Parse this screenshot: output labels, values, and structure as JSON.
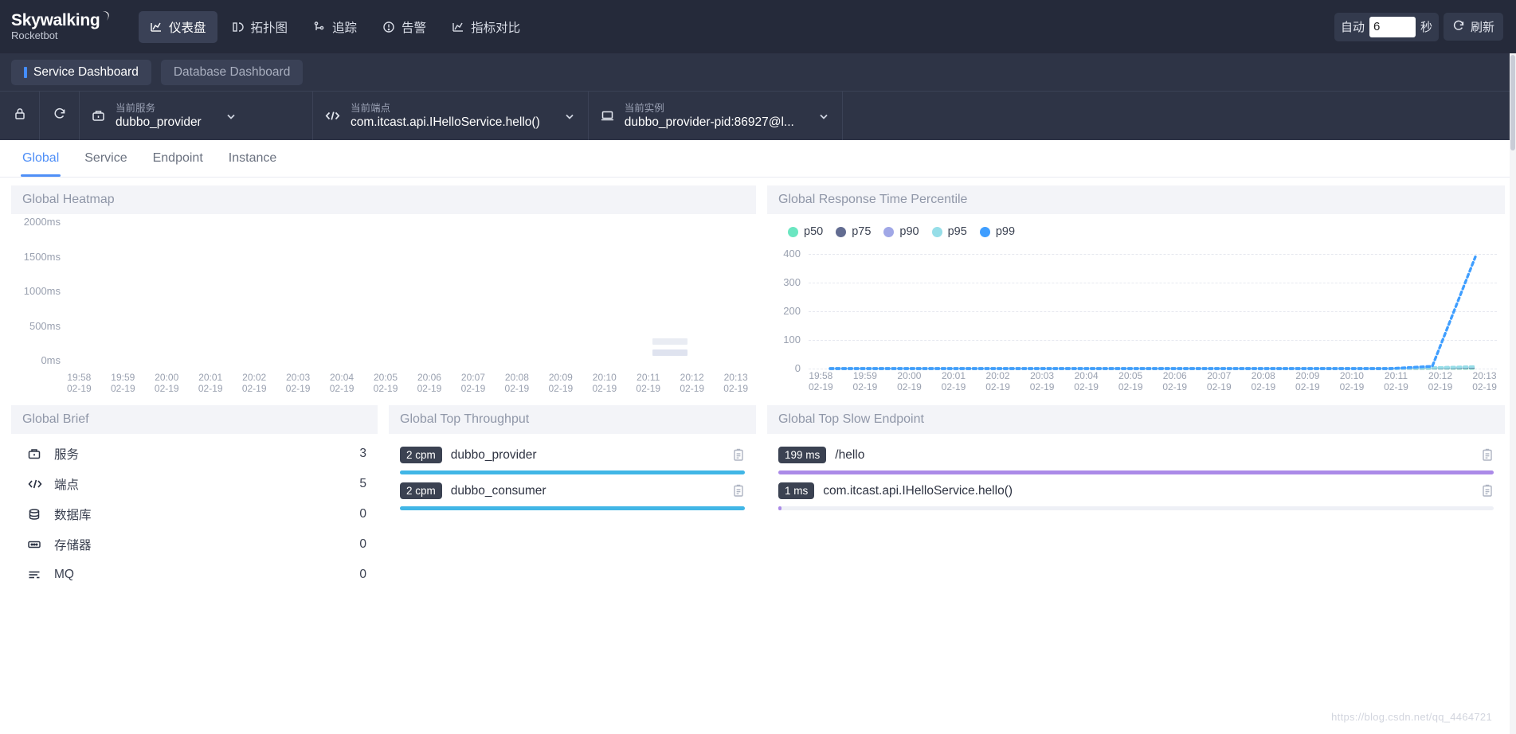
{
  "brand": {
    "name": "Skywalking",
    "sub": "Rocketbot"
  },
  "nav": {
    "items": [
      {
        "label": "仪表盘",
        "icon": "dashboard-icon",
        "active": true
      },
      {
        "label": "拓扑图",
        "icon": "topology-icon",
        "active": false
      },
      {
        "label": "追踪",
        "icon": "trace-icon",
        "active": false
      },
      {
        "label": "告警",
        "icon": "alarm-icon",
        "active": false
      },
      {
        "label": "指标对比",
        "icon": "compare-icon",
        "active": false
      }
    ],
    "auto_label": "自动",
    "auto_value": "6",
    "auto_unit": "秒",
    "refresh_label": "刷新"
  },
  "dashboard_tabs": [
    {
      "label": "Service Dashboard",
      "active": true
    },
    {
      "label": "Database Dashboard",
      "active": false
    }
  ],
  "selectors": {
    "lock_icon": "lock-icon",
    "reload_icon": "reload-icon",
    "service": {
      "label": "当前服务",
      "value": "dubbo_provider",
      "icon": "service-icon"
    },
    "endpoint": {
      "label": "当前端点",
      "value": "com.itcast.api.IHelloService.hello()",
      "icon": "endpoint-code-icon"
    },
    "instance": {
      "label": "当前实例",
      "value": "dubbo_provider-pid:86927@l...",
      "icon": "instance-icon"
    }
  },
  "subtabs": [
    {
      "label": "Global",
      "active": true
    },
    {
      "label": "Service",
      "active": false
    },
    {
      "label": "Endpoint",
      "active": false
    },
    {
      "label": "Instance",
      "active": false
    }
  ],
  "panels": {
    "heatmap_title": "Global Heatmap",
    "percentile_title": "Global Response Time Percentile",
    "brief_title": "Global Brief",
    "throughput_title": "Global Top Throughput",
    "slow_endpoint_title": "Global Top Slow Endpoint"
  },
  "brief": {
    "rows": [
      {
        "icon": "service-icon",
        "name": "服务",
        "value": "3"
      },
      {
        "icon": "endpoint-code-icon",
        "name": "端点",
        "value": "5"
      },
      {
        "icon": "database-icon",
        "name": "数据库",
        "value": "0"
      },
      {
        "icon": "cache-icon",
        "name": "存储器",
        "value": "0"
      },
      {
        "icon": "mq-icon",
        "name": "MQ",
        "value": "0"
      }
    ]
  },
  "top_throughput": {
    "items": [
      {
        "badge": "2 cpm",
        "name": "dubbo_provider",
        "pct": 100,
        "color": "#41b6e6"
      },
      {
        "badge": "2 cpm",
        "name": "dubbo_consumer",
        "pct": 100,
        "color": "#41b6e6"
      }
    ]
  },
  "top_slow_endpoint": {
    "items": [
      {
        "badge": "199 ms",
        "name": "/hello",
        "pct": 100,
        "color": "#ab8ae8"
      },
      {
        "badge": "1 ms",
        "name": "com.itcast.api.IHelloService.hello()",
        "pct": 0.5,
        "color": "#ab8ae8"
      }
    ]
  },
  "watermark": "https://blog.csdn.net/qq_4464721",
  "chart_data": [
    {
      "type": "heatmap",
      "title": "Global Heatmap",
      "xlabel": "",
      "ylabel": "",
      "ylim": [
        0,
        2000
      ],
      "ytick_labels": [
        "2000ms",
        "1500ms",
        "1000ms",
        "500ms",
        "0ms"
      ],
      "yticks": [
        2000,
        1500,
        1000,
        500,
        0
      ],
      "x": [
        "19:58",
        "19:59",
        "20:00",
        "20:01",
        "20:02",
        "20:03",
        "20:04",
        "20:05",
        "20:06",
        "20:07",
        "20:08",
        "20:09",
        "20:10",
        "20:11",
        "20:12",
        "20:13"
      ],
      "xtick_dates": [
        "02-19",
        "02-19",
        "02-19",
        "02-19",
        "02-19",
        "02-19",
        "02-19",
        "02-19",
        "02-19",
        "02-19",
        "02-19",
        "02-19",
        "02-19",
        "02-19",
        "02-19",
        "02-19"
      ],
      "grid": false,
      "cells": [
        {
          "x_index": 14,
          "bucket": "0-100ms",
          "value": 1,
          "color": "#dfe3ef"
        },
        {
          "x_index": 14,
          "bucket": "100-200ms",
          "value": 1,
          "color": "#e9ecf3"
        }
      ],
      "note": "Nearly empty heatmap; two faint light-grey cells near 20:12-20:13 close to the 0ms baseline"
    },
    {
      "type": "line",
      "title": "Global Response Time Percentile",
      "xlabel": "",
      "ylabel": "",
      "ylim": [
        0,
        400
      ],
      "yticks": [
        0,
        100,
        200,
        300,
        400
      ],
      "grid": true,
      "legend_position": "top-left",
      "x": [
        "19:58",
        "19:59",
        "20:00",
        "20:01",
        "20:02",
        "20:03",
        "20:04",
        "20:05",
        "20:06",
        "20:07",
        "20:08",
        "20:09",
        "20:10",
        "20:11",
        "20:12",
        "20:13"
      ],
      "xtick_dates": [
        "02-19",
        "02-19",
        "02-19",
        "02-19",
        "02-19",
        "02-19",
        "02-19",
        "02-19",
        "02-19",
        "02-19",
        "02-19",
        "02-19",
        "02-19",
        "02-19",
        "02-19",
        "02-19"
      ],
      "series": [
        {
          "name": "p50",
          "color": "#6be6c1",
          "values": [
            0,
            0,
            0,
            0,
            0,
            0,
            0,
            0,
            0,
            0,
            0,
            0,
            0,
            0,
            1,
            1
          ]
        },
        {
          "name": "p75",
          "color": "#626c91",
          "values": [
            0,
            0,
            0,
            0,
            0,
            0,
            0,
            0,
            0,
            0,
            0,
            0,
            0,
            0,
            2,
            4
          ]
        },
        {
          "name": "p90",
          "color": "#a0a7e6",
          "values": [
            0,
            0,
            0,
            0,
            0,
            0,
            0,
            0,
            0,
            0,
            0,
            0,
            0,
            0,
            3,
            6
          ]
        },
        {
          "name": "p95",
          "color": "#96dee8",
          "values": [
            0,
            0,
            0,
            0,
            0,
            0,
            0,
            0,
            0,
            0,
            0,
            0,
            0,
            0,
            3,
            7
          ]
        },
        {
          "name": "p99",
          "color": "#3f9eff",
          "values": [
            0,
            0,
            0,
            0,
            0,
            0,
            0,
            0,
            0,
            0,
            0,
            0,
            0,
            0,
            8,
            390
          ]
        }
      ]
    }
  ]
}
